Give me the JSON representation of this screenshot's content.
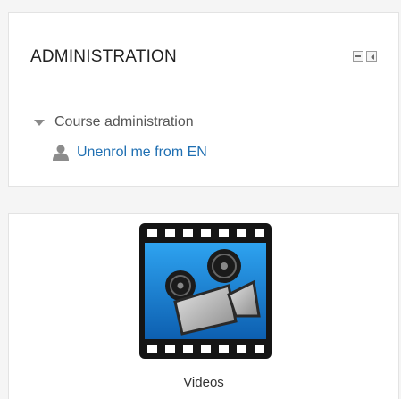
{
  "admin_block": {
    "title": "ADMINISTRATION",
    "controls": {
      "minimize_icon": "minus-box-icon",
      "dock_icon": "dock-left-icon"
    },
    "tree": {
      "section_label": "Course administration",
      "section_icon": "caret-down-icon",
      "items": [
        {
          "label": "Unenrol me from EN",
          "icon": "user-icon"
        }
      ]
    }
  },
  "videos_block": {
    "icon": "film-camera-icon",
    "label": "Videos"
  },
  "colors": {
    "link": "#1f6fb2",
    "text": "#555555",
    "title": "#222222",
    "icon_blue": "#1a8bd6"
  }
}
